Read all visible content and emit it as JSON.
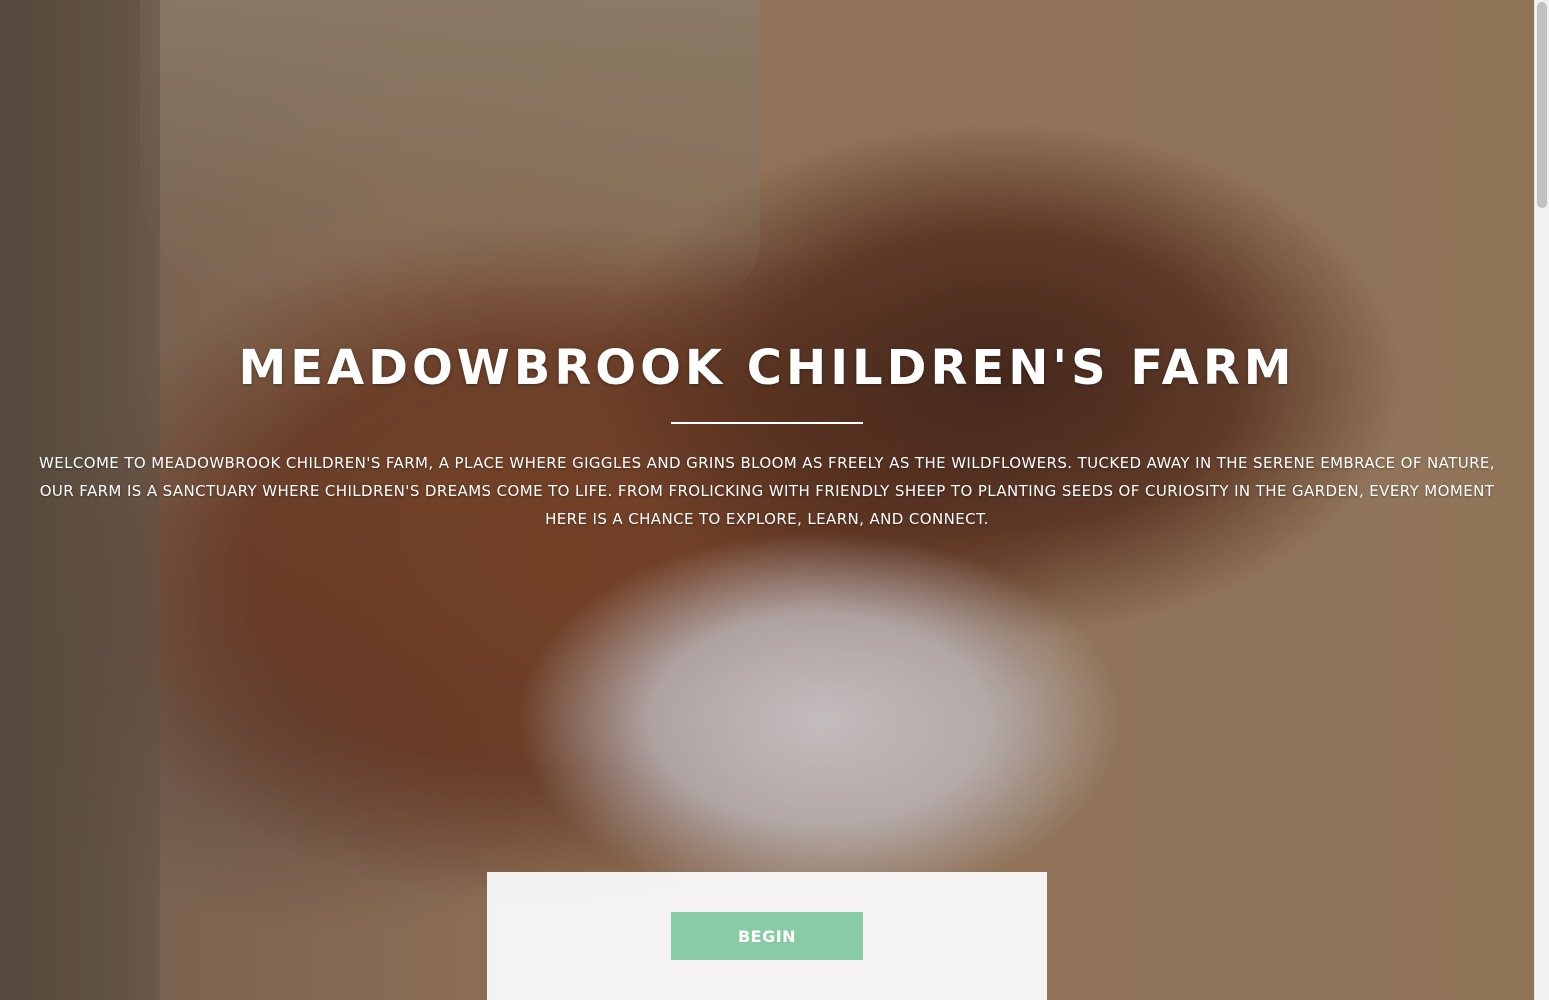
{
  "hero": {
    "title": "MEADOWBROOK CHILDREN'S FARM",
    "intro": "WELCOME TO MEADOWBROOK CHILDREN'S FARM, A PLACE WHERE GIGGLES AND GRINS BLOOM AS FREELY AS THE WILDFLOWERS. TUCKED AWAY IN THE SERENE EMBRACE OF NATURE, OUR FARM IS A SANCTUARY WHERE CHILDREN'S DREAMS COME TO LIFE. FROM FROLICKING WITH FRIENDLY SHEEP TO PLANTING SEEDS OF CURIOSITY IN THE GARDEN, EVERY MOMENT HERE IS A CHANCE TO EXPLORE, LEARN, AND CONNECT.",
    "background_image_subject": "rabbit"
  },
  "cta": {
    "begin_label": "BEGIN"
  },
  "colors": {
    "button_background": "#88cba6",
    "text": "#ffffff",
    "panel": "#fafafa"
  }
}
